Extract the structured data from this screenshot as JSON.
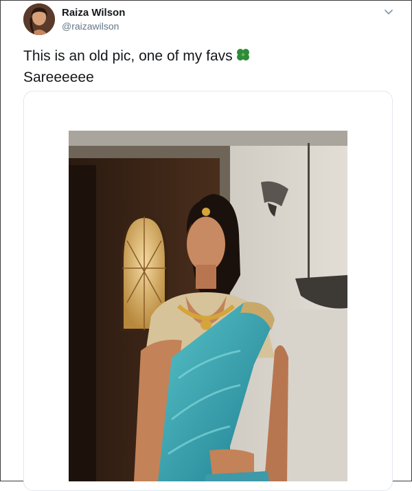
{
  "tweet": {
    "author_name": "Raiza Wilson",
    "author_handle": "@raizawilson",
    "text_line1": "This is an old pic, one of my favs",
    "text_line2": "Sareeeeee",
    "emoji_icon": "four-leaf-clover-icon"
  },
  "colors": {
    "text": "#14171a",
    "secondary_text": "#657786",
    "card_border": "#e1e8ed",
    "saree_teal": "#3aa7b5",
    "clover_green": "#2e8b3a"
  }
}
